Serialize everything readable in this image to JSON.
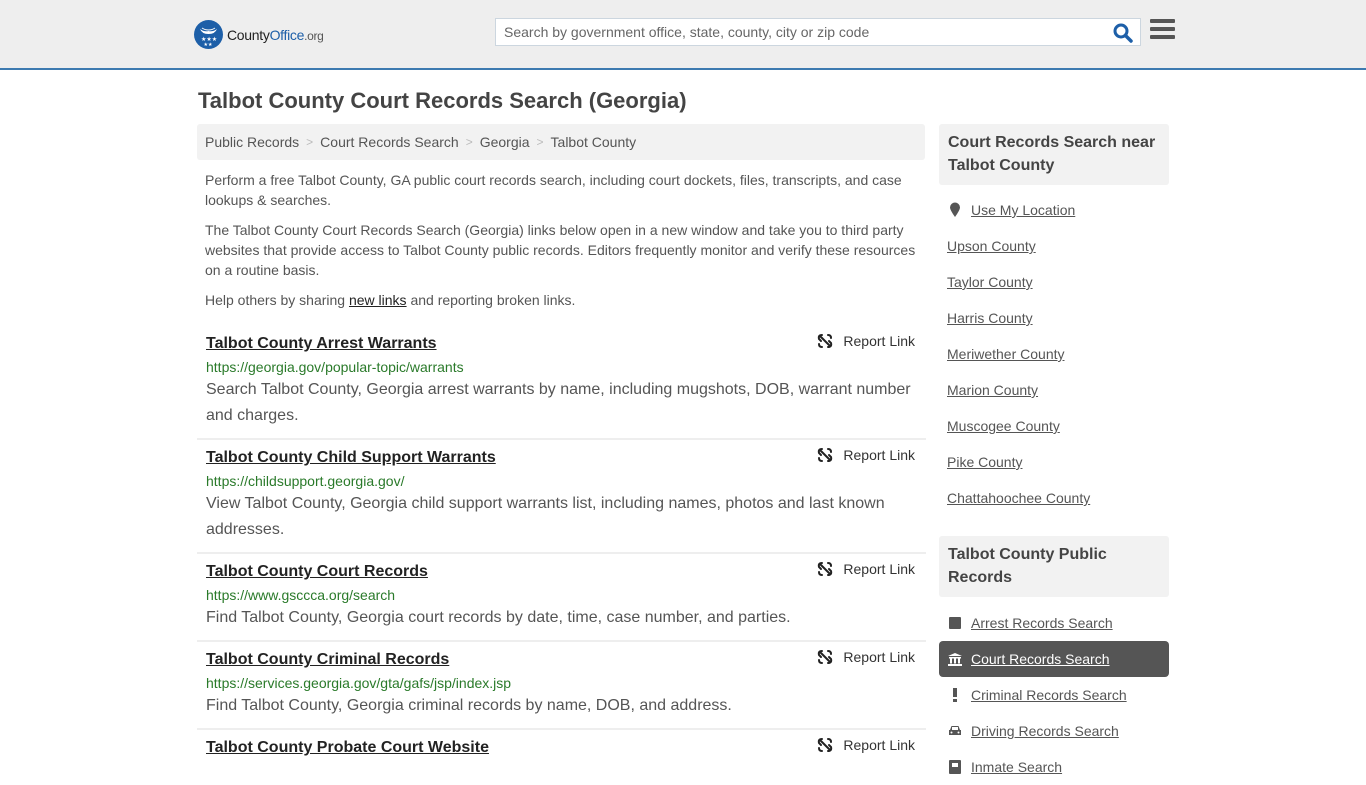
{
  "header": {
    "logo": {
      "name_main": "County",
      "name_accent": "Office",
      "name_suffix": ".org"
    },
    "search": {
      "placeholder": "Search by government office, state, county, city or zip code",
      "value": "",
      "icon": "search-icon"
    },
    "menu_icon": "hamburger-menu-icon"
  },
  "page": {
    "title": "Talbot County Court Records Search (Georgia)",
    "breadcrumb": [
      "Public Records",
      "Court Records Search",
      "Georgia",
      "Talbot County"
    ],
    "breadcrumb_separator": ">",
    "intro": {
      "p1": "Perform a free Talbot County, GA public court records search, including court dockets, files, transcripts, and case lookups & searches.",
      "p2": "The Talbot County Court Records Search (Georgia) links below open in a new window and take you to third party websites that provide access to Talbot County public records. Editors frequently monitor and verify these resources on a routine basis.",
      "p3_before": "Help others by sharing ",
      "p3_link": "new links",
      "p3_after": " and reporting broken links."
    },
    "report_label": "Report Link",
    "results": [
      {
        "title": "Talbot County Arrest Warrants",
        "url": "https://georgia.gov/popular-topic/warrants",
        "description": "Search Talbot County, Georgia arrest warrants by name, including mugshots, DOB, warrant number and charges."
      },
      {
        "title": "Talbot County Child Support Warrants",
        "url": "https://childsupport.georgia.gov/",
        "description": "View Talbot County, Georgia child support warrants list, including names, photos and last known addresses."
      },
      {
        "title": "Talbot County Court Records",
        "url": "https://www.gsccca.org/search",
        "description": "Find Talbot County, Georgia court records by date, time, case number, and parties."
      },
      {
        "title": "Talbot County Criminal Records",
        "url": "https://services.georgia.gov/gta/gafs/jsp/index.jsp",
        "description": "Find Talbot County, Georgia criminal records by name, DOB, and address."
      },
      {
        "title": "Talbot County Probate Court Website",
        "url": "",
        "description": ""
      }
    ]
  },
  "sidebar": {
    "nearby": {
      "heading": "Court Records Search near Talbot County",
      "use_location": "Use My Location",
      "counties": [
        "Upson County",
        "Taylor County",
        "Harris County",
        "Meriwether County",
        "Marion County",
        "Muscogee County",
        "Pike County",
        "Chattahoochee County"
      ]
    },
    "public_records": {
      "heading": "Talbot County Public Records",
      "items": [
        {
          "label": "Arrest Records Search",
          "icon": "square-icon",
          "active": false
        },
        {
          "label": "Court Records Search",
          "icon": "courthouse-icon",
          "active": true
        },
        {
          "label": "Criminal Records Search",
          "icon": "exclamation-icon",
          "active": false
        },
        {
          "label": "Driving Records Search",
          "icon": "car-icon",
          "active": false
        },
        {
          "label": "Inmate Search",
          "icon": "id-card-icon",
          "active": false
        }
      ]
    }
  },
  "colors": {
    "brand_blue": "#1d5fa8",
    "header_border": "#3d7ab0",
    "url_green": "#2a7a2a",
    "active_item_bg": "#555555"
  }
}
